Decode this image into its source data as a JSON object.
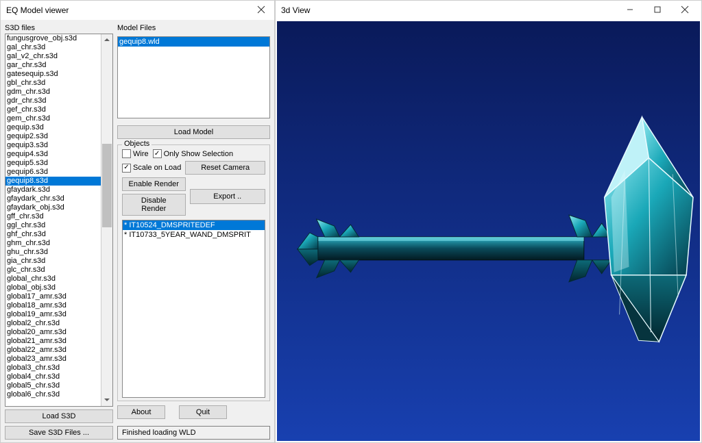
{
  "left_window": {
    "title": "EQ Model viewer",
    "s3d_label": "S3D files",
    "model_files_label": "Model Files",
    "load_s3d": "Load S3D",
    "save_s3d": "Save S3D Files ...",
    "load_model": "Load Model",
    "objects_legend": "Objects",
    "wire_label": "Wire",
    "only_show_label": "Only Show Selection",
    "scale_label": "Scale on Load",
    "reset_camera": "Reset Camera",
    "enable_render": "Enable Render",
    "disable_render": "Disable Render",
    "export": "Export ..",
    "about": "About",
    "quit": "Quit",
    "status": "Finished loading WLD"
  },
  "right_window": {
    "title": "3d View"
  },
  "s3d_files": {
    "selected_index": 16,
    "items": [
      "fungusgrove_obj.s3d",
      "gal_chr.s3d",
      "gal_v2_chr.s3d",
      "gar_chr.s3d",
      "gatesequip.s3d",
      "gbl_chr.s3d",
      "gdm_chr.s3d",
      "gdr_chr.s3d",
      "gef_chr.s3d",
      "gem_chr.s3d",
      "gequip.s3d",
      "gequip2.s3d",
      "gequip3.s3d",
      "gequip4.s3d",
      "gequip5.s3d",
      "gequip6.s3d",
      "gequip8.s3d",
      "gfaydark.s3d",
      "gfaydark_chr.s3d",
      "gfaydark_obj.s3d",
      "gff_chr.s3d",
      "ggl_chr.s3d",
      "ghf_chr.s3d",
      "ghm_chr.s3d",
      "ghu_chr.s3d",
      "gia_chr.s3d",
      "glc_chr.s3d",
      "global_chr.s3d",
      "global_obj.s3d",
      "global17_amr.s3d",
      "global18_amr.s3d",
      "global19_amr.s3d",
      "global2_chr.s3d",
      "global20_amr.s3d",
      "global21_amr.s3d",
      "global22_amr.s3d",
      "global23_amr.s3d",
      "global3_chr.s3d",
      "global4_chr.s3d",
      "global5_chr.s3d",
      "global6_chr.s3d"
    ]
  },
  "model_files": {
    "selected_index": 0,
    "items": [
      "gequip8.wld"
    ]
  },
  "checkboxes": {
    "wire": false,
    "only_show_selection": true,
    "scale_on_load": true
  },
  "objects": {
    "selected_index": 0,
    "items": [
      "* IT10524_DMSPRITEDEF",
      "* IT10733_5YEAR_WAND_DMSPRIT"
    ]
  }
}
